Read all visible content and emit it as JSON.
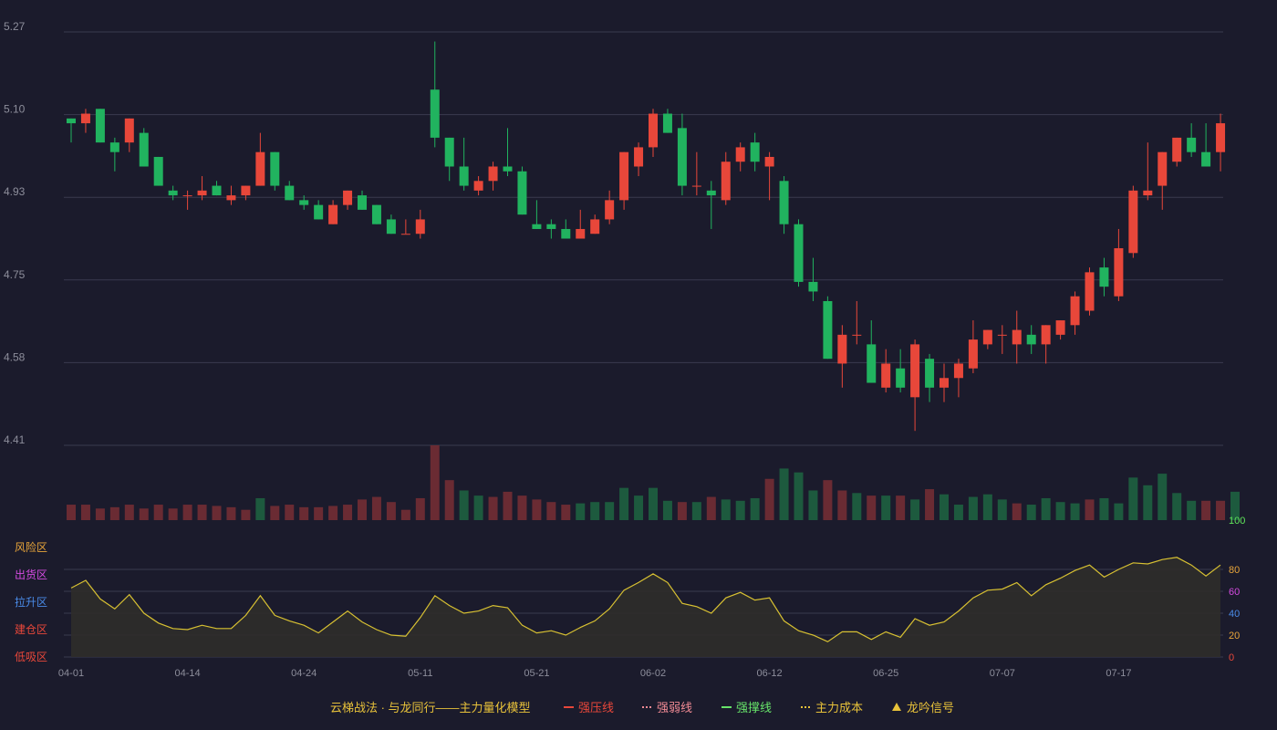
{
  "colors": {
    "background": "#1b1b2c",
    "up": "#e8473a",
    "down": "#21b35f",
    "vol_up": "#6a2b33",
    "vol_down": "#1d5a3e",
    "grid": "#3a3b4e",
    "axis_text": "#8d8e9b",
    "indicator_line": "#d8c132",
    "indicator_fill": "#2f2d2a"
  },
  "chart_data": [
    {
      "type": "candlestick",
      "ylim": [
        4.41,
        5.27
      ],
      "y_ticks": [
        "5.27",
        "5.10",
        "4.93",
        "4.75",
        "4.58",
        "4.41"
      ],
      "x_ticks": [
        {
          "index": 0,
          "label": "04-01"
        },
        {
          "index": 8,
          "label": "04-14"
        },
        {
          "index": 16,
          "label": "04-24"
        },
        {
          "index": 24,
          "label": "05-11"
        },
        {
          "index": 32,
          "label": "05-21"
        },
        {
          "index": 40,
          "label": "06-02"
        },
        {
          "index": 48,
          "label": "06-12"
        },
        {
          "index": 56,
          "label": "06-25"
        },
        {
          "index": 64,
          "label": "07-07"
        },
        {
          "index": 72,
          "label": "07-17"
        }
      ],
      "ohlc": [
        [
          5.09,
          5.09,
          5.04,
          5.08
        ],
        [
          5.08,
          5.11,
          5.06,
          5.1
        ],
        [
          5.11,
          5.11,
          5.04,
          5.04
        ],
        [
          5.04,
          5.05,
          4.98,
          5.02
        ],
        [
          5.04,
          5.09,
          5.02,
          5.09
        ],
        [
          5.06,
          5.07,
          4.99,
          4.99
        ],
        [
          5.01,
          5.01,
          4.95,
          4.95
        ],
        [
          4.94,
          4.95,
          4.92,
          4.93
        ],
        [
          4.93,
          4.94,
          4.9,
          4.93
        ],
        [
          4.93,
          4.97,
          4.92,
          4.94
        ],
        [
          4.95,
          4.96,
          4.93,
          4.93
        ],
        [
          4.92,
          4.95,
          4.91,
          4.93
        ],
        [
          4.93,
          4.95,
          4.92,
          4.95
        ],
        [
          4.95,
          5.06,
          4.95,
          5.02
        ],
        [
          5.02,
          5.02,
          4.94,
          4.95
        ],
        [
          4.95,
          4.96,
          4.92,
          4.92
        ],
        [
          4.92,
          4.93,
          4.9,
          4.91
        ],
        [
          4.91,
          4.92,
          4.88,
          4.88
        ],
        [
          4.87,
          4.92,
          4.87,
          4.91
        ],
        [
          4.91,
          4.94,
          4.9,
          4.94
        ],
        [
          4.93,
          4.94,
          4.9,
          4.9
        ],
        [
          4.91,
          4.91,
          4.87,
          4.87
        ],
        [
          4.88,
          4.89,
          4.85,
          4.85
        ],
        [
          4.85,
          4.88,
          4.85,
          4.85
        ],
        [
          4.85,
          4.9,
          4.84,
          4.88
        ],
        [
          5.15,
          5.25,
          5.03,
          5.05
        ],
        [
          5.05,
          5.05,
          4.96,
          4.99
        ],
        [
          4.99,
          5.05,
          4.94,
          4.95
        ],
        [
          4.94,
          4.97,
          4.93,
          4.96
        ],
        [
          4.96,
          5.0,
          4.94,
          4.99
        ],
        [
          4.99,
          5.07,
          4.97,
          4.98
        ],
        [
          4.98,
          4.99,
          4.89,
          4.89
        ],
        [
          4.87,
          4.92,
          4.86,
          4.86
        ],
        [
          4.87,
          4.88,
          4.84,
          4.86
        ],
        [
          4.86,
          4.88,
          4.84,
          4.84
        ],
        [
          4.84,
          4.9,
          4.84,
          4.86
        ],
        [
          4.85,
          4.89,
          4.85,
          4.88
        ],
        [
          4.88,
          4.94,
          4.87,
          4.92
        ],
        [
          4.92,
          5.02,
          4.9,
          5.02
        ],
        [
          4.99,
          5.04,
          4.97,
          5.03
        ],
        [
          5.03,
          5.11,
          5.01,
          5.1
        ],
        [
          5.1,
          5.11,
          5.06,
          5.06
        ],
        [
          5.07,
          5.1,
          4.93,
          4.95
        ],
        [
          4.95,
          5.02,
          4.93,
          4.95
        ],
        [
          4.94,
          4.96,
          4.86,
          4.93
        ],
        [
          4.92,
          5.02,
          4.91,
          5.0
        ],
        [
          5.0,
          5.04,
          4.98,
          5.03
        ],
        [
          5.04,
          5.06,
          4.98,
          5.0
        ],
        [
          4.99,
          5.02,
          4.92,
          5.01
        ],
        [
          4.96,
          4.97,
          4.85,
          4.87
        ],
        [
          4.87,
          4.88,
          4.74,
          4.75
        ],
        [
          4.75,
          4.8,
          4.71,
          4.73
        ],
        [
          4.71,
          4.72,
          4.59,
          4.59
        ],
        [
          4.58,
          4.66,
          4.53,
          4.64
        ],
        [
          4.64,
          4.71,
          4.62,
          4.64
        ],
        [
          4.62,
          4.67,
          4.54,
          4.54
        ],
        [
          4.53,
          4.61,
          4.52,
          4.58
        ],
        [
          4.57,
          4.61,
          4.52,
          4.53
        ],
        [
          4.51,
          4.63,
          4.44,
          4.62
        ],
        [
          4.59,
          4.6,
          4.5,
          4.53
        ],
        [
          4.53,
          4.58,
          4.5,
          4.55
        ],
        [
          4.55,
          4.59,
          4.51,
          4.58
        ],
        [
          4.57,
          4.67,
          4.56,
          4.63
        ],
        [
          4.62,
          4.65,
          4.61,
          4.65
        ],
        [
          4.64,
          4.66,
          4.6,
          4.64
        ],
        [
          4.62,
          4.69,
          4.58,
          4.65
        ],
        [
          4.64,
          4.66,
          4.6,
          4.62
        ],
        [
          4.62,
          4.66,
          4.58,
          4.66
        ],
        [
          4.64,
          4.67,
          4.63,
          4.67
        ],
        [
          4.66,
          4.73,
          4.64,
          4.72
        ],
        [
          4.69,
          4.78,
          4.68,
          4.77
        ],
        [
          4.78,
          4.8,
          4.72,
          4.74
        ],
        [
          4.72,
          4.86,
          4.71,
          4.82
        ],
        [
          4.81,
          4.95,
          4.8,
          4.94
        ],
        [
          4.93,
          5.04,
          4.92,
          4.94
        ],
        [
          4.95,
          5.02,
          4.9,
          5.02
        ],
        [
          5.0,
          5.05,
          4.99,
          5.05
        ],
        [
          5.05,
          5.08,
          5.01,
          5.02
        ],
        [
          5.02,
          5.08,
          4.99,
          4.99
        ],
        [
          5.02,
          5.1,
          4.98,
          5.08
        ]
      ],
      "volume_up": [
        true,
        true,
        true,
        true,
        true,
        true,
        true,
        true,
        true,
        true,
        true,
        true,
        true,
        false,
        true,
        true,
        true,
        true,
        true,
        true,
        true,
        true,
        true,
        true,
        true,
        true,
        true,
        false,
        false,
        true,
        true,
        true,
        true,
        true,
        true,
        false,
        false,
        false,
        false,
        false,
        false,
        false,
        true,
        false,
        true,
        false,
        false,
        false,
        true,
        false,
        false,
        false,
        true,
        true,
        false,
        true,
        false,
        true,
        false,
        true,
        false,
        false,
        false,
        false,
        false,
        true,
        false,
        false,
        false,
        false,
        true,
        false,
        false,
        false,
        false,
        false,
        false,
        false,
        true,
        true,
        false
      ]
    },
    {
      "type": "bar",
      "title": "volume",
      "values": [
        12,
        12,
        9,
        10,
        12,
        9,
        12,
        9,
        12,
        12,
        11,
        10,
        8,
        17,
        11,
        12,
        10,
        10,
        11,
        12,
        16,
        18,
        14,
        8,
        17,
        58,
        31,
        23,
        19,
        18,
        22,
        19,
        16,
        14,
        12,
        13,
        14,
        14,
        25,
        19,
        25,
        15,
        14,
        14,
        18,
        16,
        15,
        17,
        32,
        40,
        37,
        23,
        31,
        23,
        21,
        19,
        19,
        19,
        16,
        24,
        20,
        12,
        18,
        20,
        16,
        13,
        12,
        17,
        14,
        13,
        16,
        17,
        13,
        33,
        27,
        36,
        21,
        15,
        15,
        15,
        22
      ],
      "ylim": [
        0,
        58
      ]
    },
    {
      "type": "area",
      "values": [
        63,
        70,
        53,
        44,
        57,
        40,
        31,
        26,
        25,
        29,
        26,
        26,
        38,
        56,
        38,
        33,
        29,
        22,
        32,
        42,
        32,
        25,
        20,
        19,
        36,
        56,
        47,
        40,
        42,
        47,
        45,
        29,
        22,
        24,
        20,
        27,
        33,
        44,
        61,
        68,
        76,
        68,
        49,
        46,
        40,
        54,
        59,
        52,
        54,
        33,
        24,
        20,
        14,
        23,
        23,
        16,
        23,
        18,
        35,
        29,
        32,
        42,
        54,
        61,
        62,
        68,
        56,
        66,
        72,
        79,
        84,
        73,
        80,
        86,
        85,
        89,
        91,
        84,
        74,
        84
      ],
      "ylim": [
        0,
        100
      ],
      "y_ticks": [
        "100",
        "80",
        "60",
        "40",
        "20",
        "0"
      ],
      "zones": [
        "风险区",
        "出货区",
        "拉升区",
        "建仓区",
        "低吸区"
      ]
    }
  ],
  "legend": {
    "title": "云梯战法 · 与龙同行——主力量化模型",
    "items": [
      {
        "label": "强压线",
        "color": "#e8473a",
        "style": "solid"
      },
      {
        "label": "强弱线",
        "color": "#f08a94",
        "style": "dashed"
      },
      {
        "label": "强撑线",
        "color": "#67e36a",
        "style": "solid"
      },
      {
        "label": "主力成本",
        "color": "#e8c23a",
        "style": "dashed"
      },
      {
        "label": "龙吟信号",
        "color": "#e8c23a",
        "style": "triangle"
      }
    ]
  }
}
